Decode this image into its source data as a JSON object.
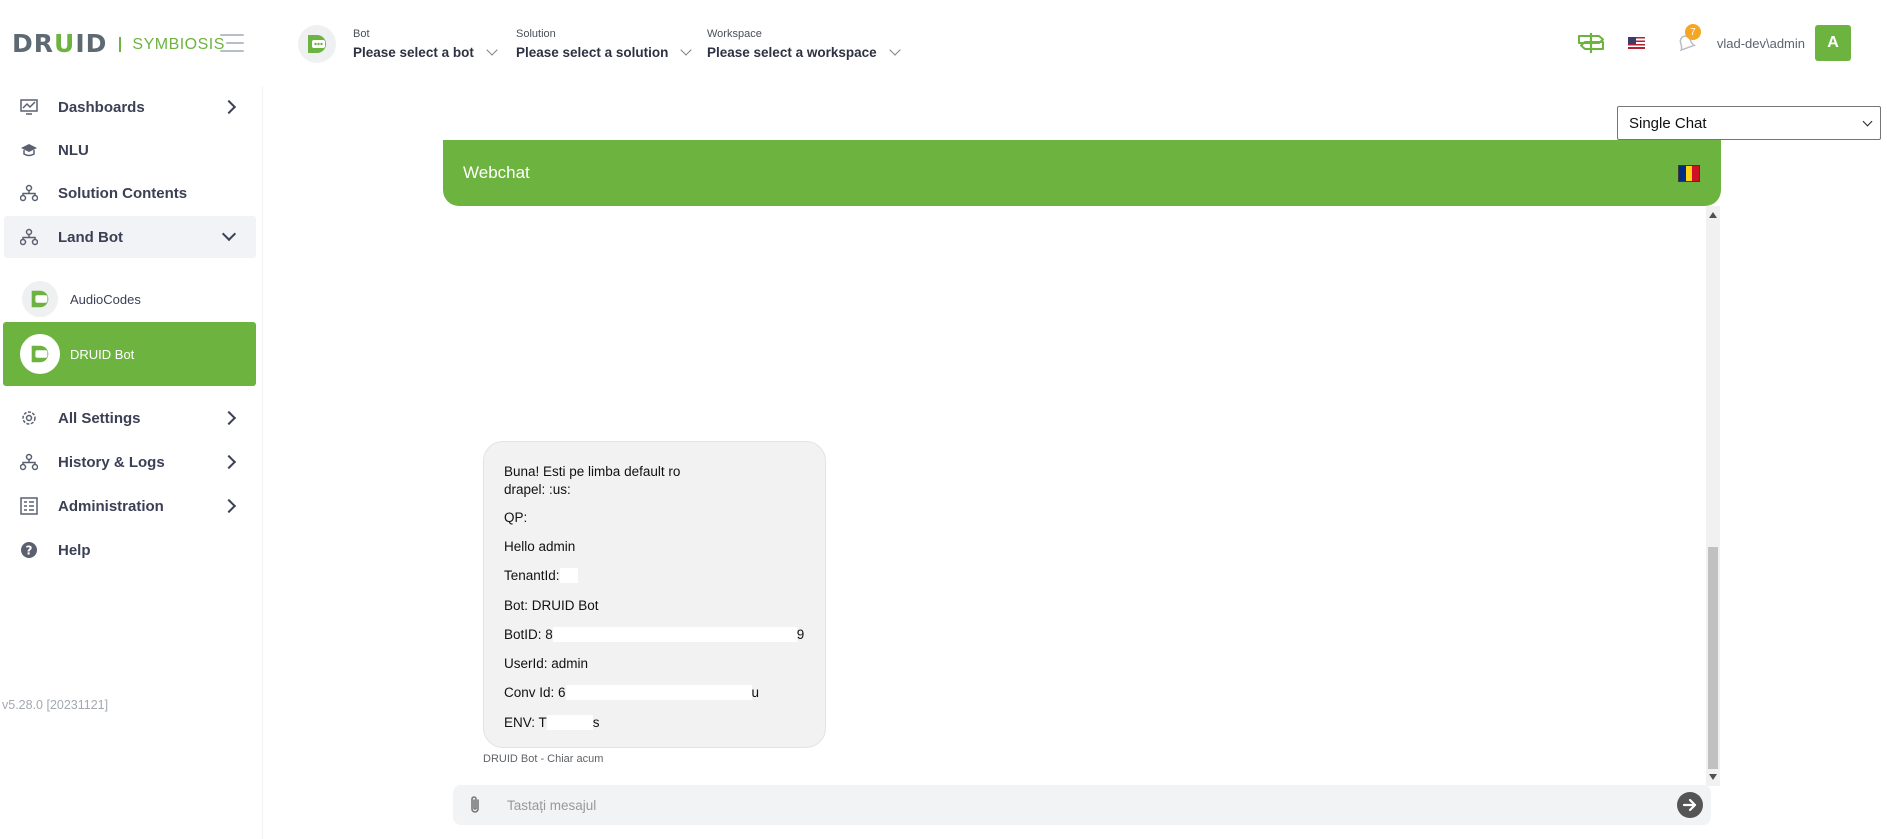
{
  "header": {
    "logo_main": "DRUID",
    "logo_sub": "SYMBIOSIS",
    "bot_selector": {
      "label": "Bot",
      "value": "Please select a bot"
    },
    "solution_selector": {
      "label": "Solution",
      "value": "Please select a solution"
    },
    "workspace_selector": {
      "label": "Workspace",
      "value": "Please select a workspace"
    },
    "notification_count": "7",
    "username": "vlad-dev\\admin",
    "user_initial": "A",
    "accent_color": "#6db33f"
  },
  "sidebar": {
    "items": [
      {
        "label": "Dashboards",
        "icon": "dashboard-icon"
      },
      {
        "label": "NLU",
        "icon": "graduation-cap-icon"
      },
      {
        "label": "Solution Contents",
        "icon": "sitemap-icon"
      },
      {
        "label": "Land Bot",
        "icon": "sitemap-icon"
      },
      {
        "label": "All Settings",
        "icon": "gear-icon"
      },
      {
        "label": "History & Logs",
        "icon": "sitemap-icon"
      },
      {
        "label": "Administration",
        "icon": "admin-panel-icon"
      },
      {
        "label": "Help",
        "icon": "question-circle-icon"
      }
    ],
    "sub_items": [
      {
        "label": "AudioCodes"
      },
      {
        "label": "DRUID Bot"
      }
    ],
    "version": "v5.28.0 [20231121]"
  },
  "main": {
    "mode_select": {
      "value": "Single Chat"
    },
    "webchat": {
      "title": "Webchat",
      "message_lines": [
        "Buna! Esti pe limba default ro",
        "drapel: :us:",
        "QP:",
        "Hello admin",
        "TenantId:",
        "Bot: DRUID Bot",
        "BotID: 8",
        "9",
        "UserId: admin",
        "Conv Id: 6",
        "u",
        "ENV: T",
        "s"
      ],
      "message_meta": "DRUID Bot - Chiar acum",
      "input_placeholder": "Tastați mesajul"
    }
  }
}
